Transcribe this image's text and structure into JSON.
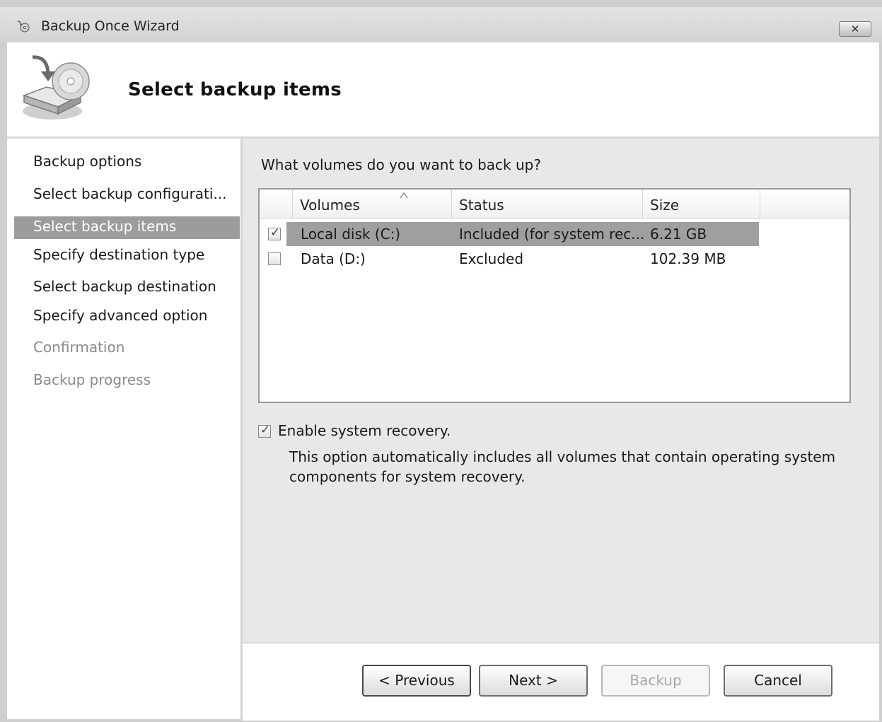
{
  "window": {
    "title": "Backup Once Wizard",
    "close_label": "✕"
  },
  "header": {
    "title": "Select backup items"
  },
  "sidebar": {
    "steps": [
      {
        "label": "Backup options",
        "state": "enabled"
      },
      {
        "label": "Select backup configurati...",
        "state": "enabled"
      },
      {
        "label": "Select backup items",
        "state": "active"
      },
      {
        "label": "Specify destination type",
        "state": "enabled"
      },
      {
        "label": "Select backup destination",
        "state": "enabled"
      },
      {
        "label": "Specify advanced option",
        "state": "enabled"
      },
      {
        "label": "Confirmation",
        "state": "disabled"
      },
      {
        "label": "Backup progress",
        "state": "disabled"
      }
    ]
  },
  "main": {
    "question": "What volumes do you want to back up?",
    "table": {
      "columns": [
        "Volumes",
        "Status",
        "Size"
      ],
      "sorted_column": "Volumes",
      "rows": [
        {
          "checked": true,
          "volume": "Local disk (C:)",
          "status": "Included (for system rec...",
          "size": "6.21 GB",
          "selected": true
        },
        {
          "checked": false,
          "volume": "Data (D:)",
          "status": "Excluded",
          "size": "102.39 MB",
          "selected": false
        }
      ]
    },
    "recovery": {
      "checked": true,
      "label": "Enable system recovery.",
      "description": "This option automatically includes all volumes that contain operating system components for system recovery."
    }
  },
  "buttons": {
    "previous": "< Previous",
    "next": "Next >",
    "backup": "Backup",
    "cancel": "Cancel"
  },
  "colors": {
    "selection": "#9f9f9f",
    "disabled_text": "#8a8a8a"
  }
}
